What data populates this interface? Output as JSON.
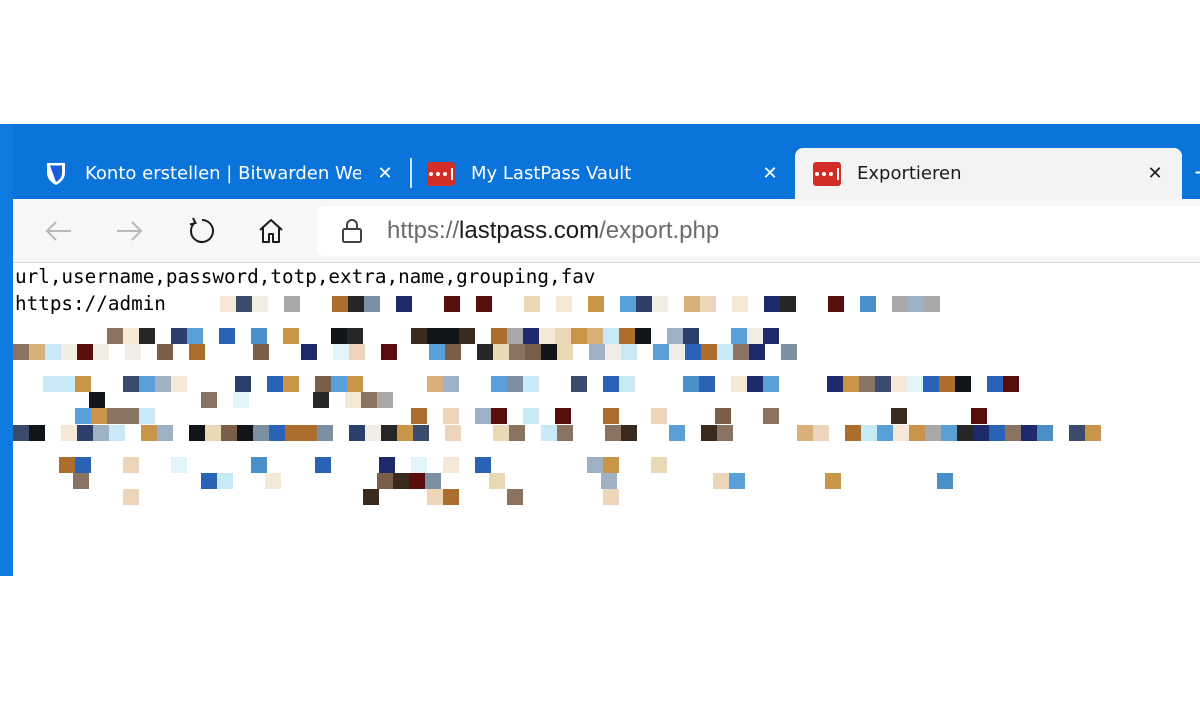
{
  "tabs": [
    {
      "label": "Konto erstellen | Bitwarden Web-",
      "favicon": "bitwarden-shield-icon",
      "active": false
    },
    {
      "label": "My LastPass Vault",
      "favicon": "lastpass-icon",
      "active": false
    },
    {
      "label": "Exportieren",
      "favicon": "lastpass-icon",
      "active": true
    }
  ],
  "new_tab_glyph": "+",
  "close_glyph": "✕",
  "toolbar": {
    "back_icon": "back-arrow-icon",
    "forward_icon": "forward-arrow-icon",
    "refresh_icon": "refresh-icon",
    "home_icon": "home-icon",
    "lock_icon": "lock-icon"
  },
  "address": {
    "scheme": "https://",
    "domain": "lastpass.com",
    "path": "/export.php"
  },
  "content": {
    "header_line": "url,username,password,totp,extra,name,grouping,fav",
    "first_record_prefix": "https://admin"
  },
  "colors": {
    "tabbar": "#0a74da",
    "lastpass_red": "#d32d27",
    "bitwarden_blue": "#175ddc"
  }
}
